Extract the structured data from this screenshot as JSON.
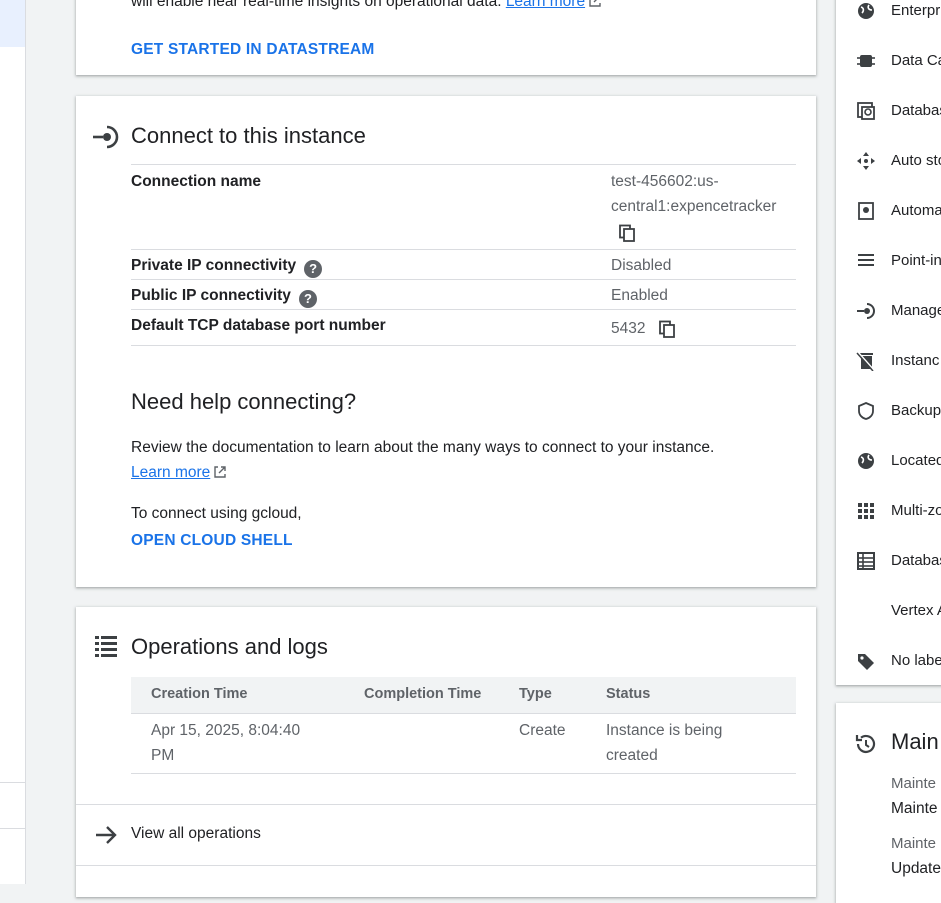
{
  "datastream_card": {
    "partial_text": "will enable near real-time insights on operational data.",
    "learn_more": "Learn more",
    "action": "GET STARTED IN DATASTREAM"
  },
  "connect_card": {
    "title": "Connect to this instance",
    "rows": [
      {
        "label": "Connection name",
        "value_line1": "test-456602:us-",
        "value_line2": "central1:expencetracker"
      },
      {
        "label": "Private IP connectivity",
        "value": "Disabled"
      },
      {
        "label": "Public IP connectivity",
        "value": "Enabled"
      },
      {
        "label": "Default TCP database port number",
        "value": "5432"
      }
    ],
    "help_title": "Need help connecting?",
    "help_text": "Review the documentation to learn about the many ways to connect to your instance.",
    "learn_more": "Learn more",
    "gcloud_text": "To connect using gcloud,",
    "shell_action": "OPEN CLOUD SHELL"
  },
  "ops_card": {
    "title": "Operations and logs",
    "columns": [
      "Creation Time",
      "Completion Time",
      "Type",
      "Status"
    ],
    "rows": [
      {
        "creation_l1": "Apr 15, 2025, 8:04:40",
        "creation_l2": "PM",
        "completion": "",
        "type": "Create",
        "status_l1": "Instance is being",
        "status_l2": "created"
      }
    ],
    "view_all": "View all operations"
  },
  "right_panel": {
    "items": [
      {
        "icon": "globe-icon",
        "label": "Enterpri"
      },
      {
        "icon": "chip-icon",
        "label": "Data Ca"
      },
      {
        "icon": "database-icon",
        "label": "Databas"
      },
      {
        "icon": "arrows-icon",
        "label": "Auto sto"
      },
      {
        "icon": "backup-icon",
        "label": "Automa"
      },
      {
        "icon": "list-icon",
        "label": "Point-in"
      },
      {
        "icon": "connection-icon",
        "label": "Manage"
      },
      {
        "icon": "trash-icon",
        "label": "Instanc"
      },
      {
        "icon": "shield-icon",
        "label": "Backup"
      },
      {
        "icon": "globe-icon",
        "label": "Located"
      },
      {
        "icon": "grid-icon",
        "label": "Multi-zo"
      },
      {
        "icon": "table-icon",
        "label": "Databas"
      },
      {
        "icon": "",
        "label": "Vertex A"
      },
      {
        "icon": "tag-icon",
        "label": "No labe"
      }
    ]
  },
  "maintenance_card": {
    "title": "Main",
    "line1_label": "Mainte",
    "line1_value": "Mainte",
    "line2_label": "Mainte",
    "line2_value": "Update"
  }
}
